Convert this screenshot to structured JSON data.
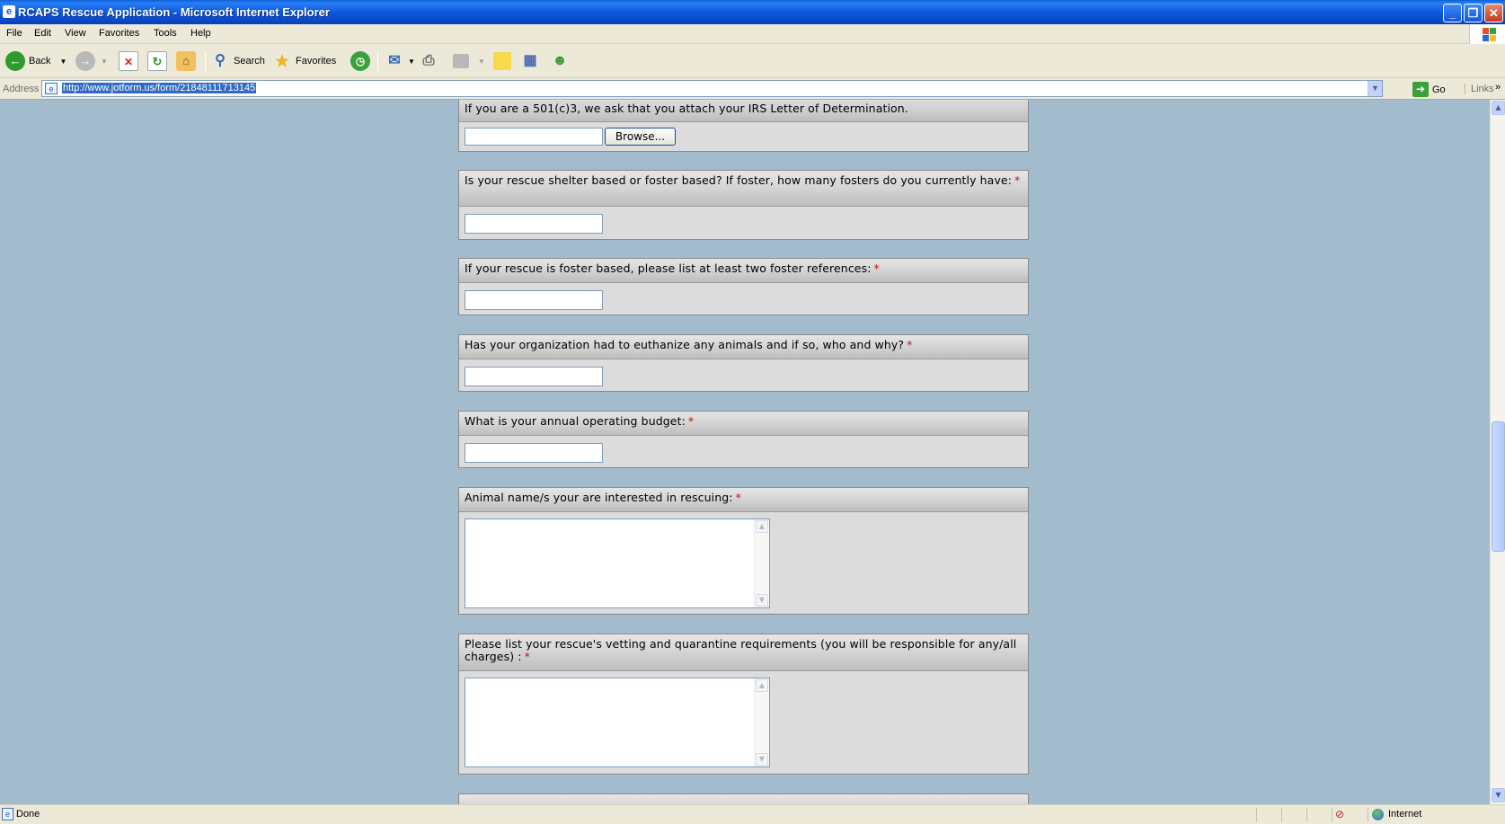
{
  "window": {
    "title": "RCAPS Rescue Application - Microsoft Internet Explorer",
    "minimize_glyph": "_",
    "restore_glyph": "❐",
    "close_glyph": "✕"
  },
  "menu": {
    "items": [
      "File",
      "Edit",
      "View",
      "Favorites",
      "Tools",
      "Help"
    ]
  },
  "toolbar": {
    "back_label": "Back",
    "search_label": "Search",
    "favorites_label": "Favorites"
  },
  "address": {
    "label": "Address",
    "url": "http://www.jotform.us/form/21848111713145",
    "go_label": "Go",
    "links_label": "Links"
  },
  "form": {
    "questions": [
      {
        "label": "If you are a 501(c)3, we ask that you attach your IRS Letter of Determination.",
        "required": false,
        "field": "file",
        "browse_label": "Browse..."
      },
      {
        "label": "Is your rescue shelter based or foster based? If foster, how many fosters do you currently have:",
        "required": true,
        "field": "text"
      },
      {
        "label": "If your rescue is foster based, please list at least two foster references:",
        "required": true,
        "field": "text"
      },
      {
        "label": "Has your organization had to euthanize any animals and if so, who and why?",
        "required": true,
        "field": "text"
      },
      {
        "label": "What is your annual operating budget:",
        "required": true,
        "field": "text"
      },
      {
        "label": "Animal name/s your are interested in rescuing:",
        "required": true,
        "field": "textarea"
      },
      {
        "label": "Please list your rescue's vetting and quarantine requirements (you will be responsible for any/all charges) :",
        "required": true,
        "field": "textarea"
      }
    ],
    "required_mark": "*"
  },
  "status": {
    "text": "Done",
    "zone": "Internet"
  },
  "colors": {
    "page_background": "#a3bccd",
    "required_mark": "#d01010",
    "titlebar": "#0b5ae0"
  }
}
